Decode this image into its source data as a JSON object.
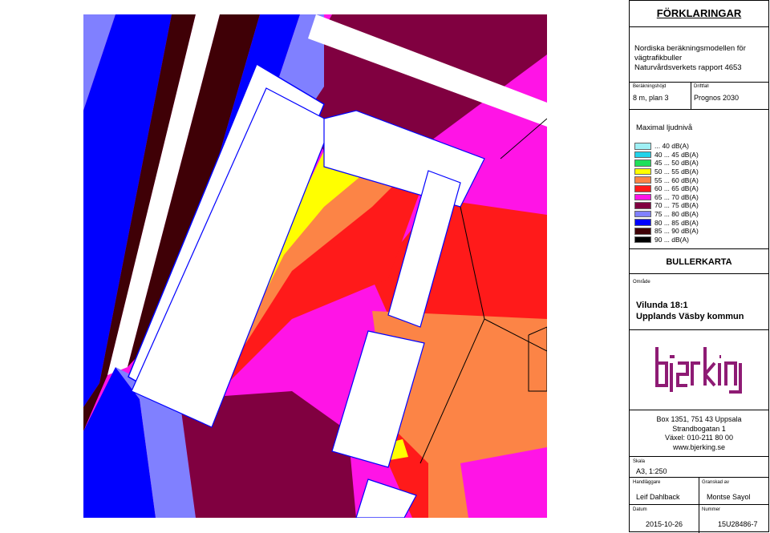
{
  "panel": {
    "title": "FÖRKLARINGAR",
    "model_lines": [
      "Nordiska beräkningsmodellen för",
      "vägtrafikbuller",
      "Naturvårdsverkets rapport 4653"
    ],
    "calc_height_label": "Beräkningshöjd",
    "calc_height": "8 m, plan 3",
    "scenario_label": "Driftfall",
    "scenario": "Prognos 2030",
    "legend_title": "Maximal ljudnivå",
    "legend": [
      {
        "label": "... 40 dB(A)",
        "color": "#9ff0f5"
      },
      {
        "label": "40 ... 45 dB(A)",
        "color": "#22d3ea"
      },
      {
        "label": "45 ... 50 dB(A)",
        "color": "#1fe05a"
      },
      {
        "label": "50 ... 55 dB(A)",
        "color": "#ffff00"
      },
      {
        "label": "55 ... 60 dB(A)",
        "color": "#fc8446"
      },
      {
        "label": "60 ... 65 dB(A)",
        "color": "#ff1a1a"
      },
      {
        "label": "65 ... 70 dB(A)",
        "color": "#ff14e6"
      },
      {
        "label": "70 ... 75 dB(A)",
        "color": "#800040"
      },
      {
        "label": "75 ... 80 dB(A)",
        "color": "#8080ff"
      },
      {
        "label": "80 ... 85 dB(A)",
        "color": "#0000ff"
      },
      {
        "label": "85 ... 90 dB(A)",
        "color": "#3f0006"
      },
      {
        "label": "90 ... dB(A)",
        "color": "#000000"
      }
    ],
    "map_title": "BULLERKARTA",
    "area_label": "Område",
    "area_lines": [
      "Vilunda 18:1",
      "Upplands Väsby kommun"
    ],
    "logo_text": "bjerking",
    "logo_color": "#8e1b74",
    "address_lines": [
      "Box 1351, 751 43 Uppsala",
      "Strandbogatan 1",
      "Växel: 010-211 80 00",
      "www.bjerking.se"
    ],
    "scale_label": "Skala",
    "scale": "A3, 1:250",
    "handler_label": "Handläggare",
    "handler": "Leif Dahlback",
    "reviewer_label": "Granskad av",
    "reviewer": "Montse Sayol",
    "date_label": "Datum",
    "date": "2015-10-26",
    "number_label": "Nummer",
    "number": "15U28486-7"
  }
}
